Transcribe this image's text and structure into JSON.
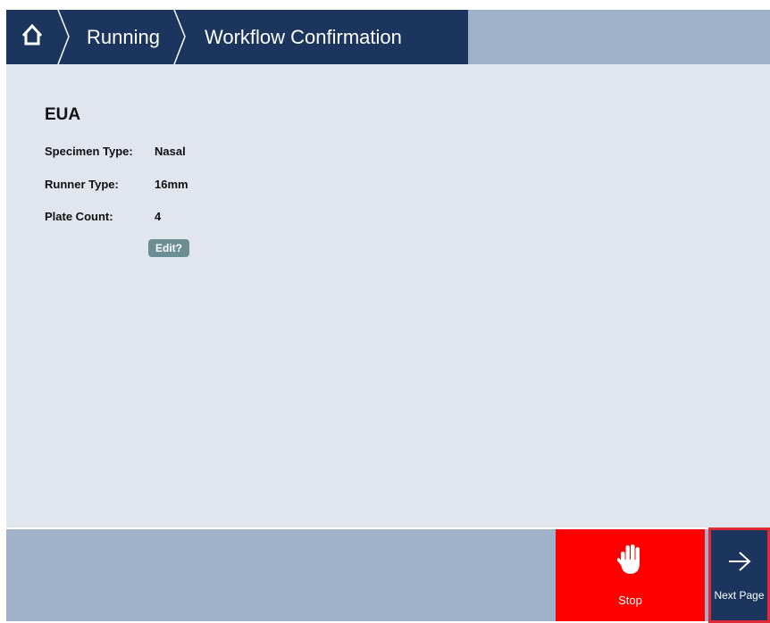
{
  "header": {
    "breadcrumbs": [
      "Running",
      "Workflow Confirmation"
    ],
    "home_icon": "home-icon"
  },
  "workflow": {
    "title": "EUA",
    "fields": [
      {
        "label": "Specimen Type:",
        "value": "Nasal"
      },
      {
        "label": "Runner Type:",
        "value": "16mm"
      },
      {
        "label": "Plate Count:",
        "value": "4"
      }
    ],
    "edit_label": "Edit?"
  },
  "footer": {
    "stop_label": "Stop",
    "stop_icon": "hand-stop-icon",
    "next_label": "Next Page",
    "next_icon": "arrow-right-icon"
  },
  "colors": {
    "nav_dark": "#1b355f",
    "bar_light": "#9fb2c9",
    "background": "#e1e5ee",
    "stop_red": "#ff0000",
    "edit_button": "#6c8e92",
    "highlight_outline": "#e02a35"
  }
}
